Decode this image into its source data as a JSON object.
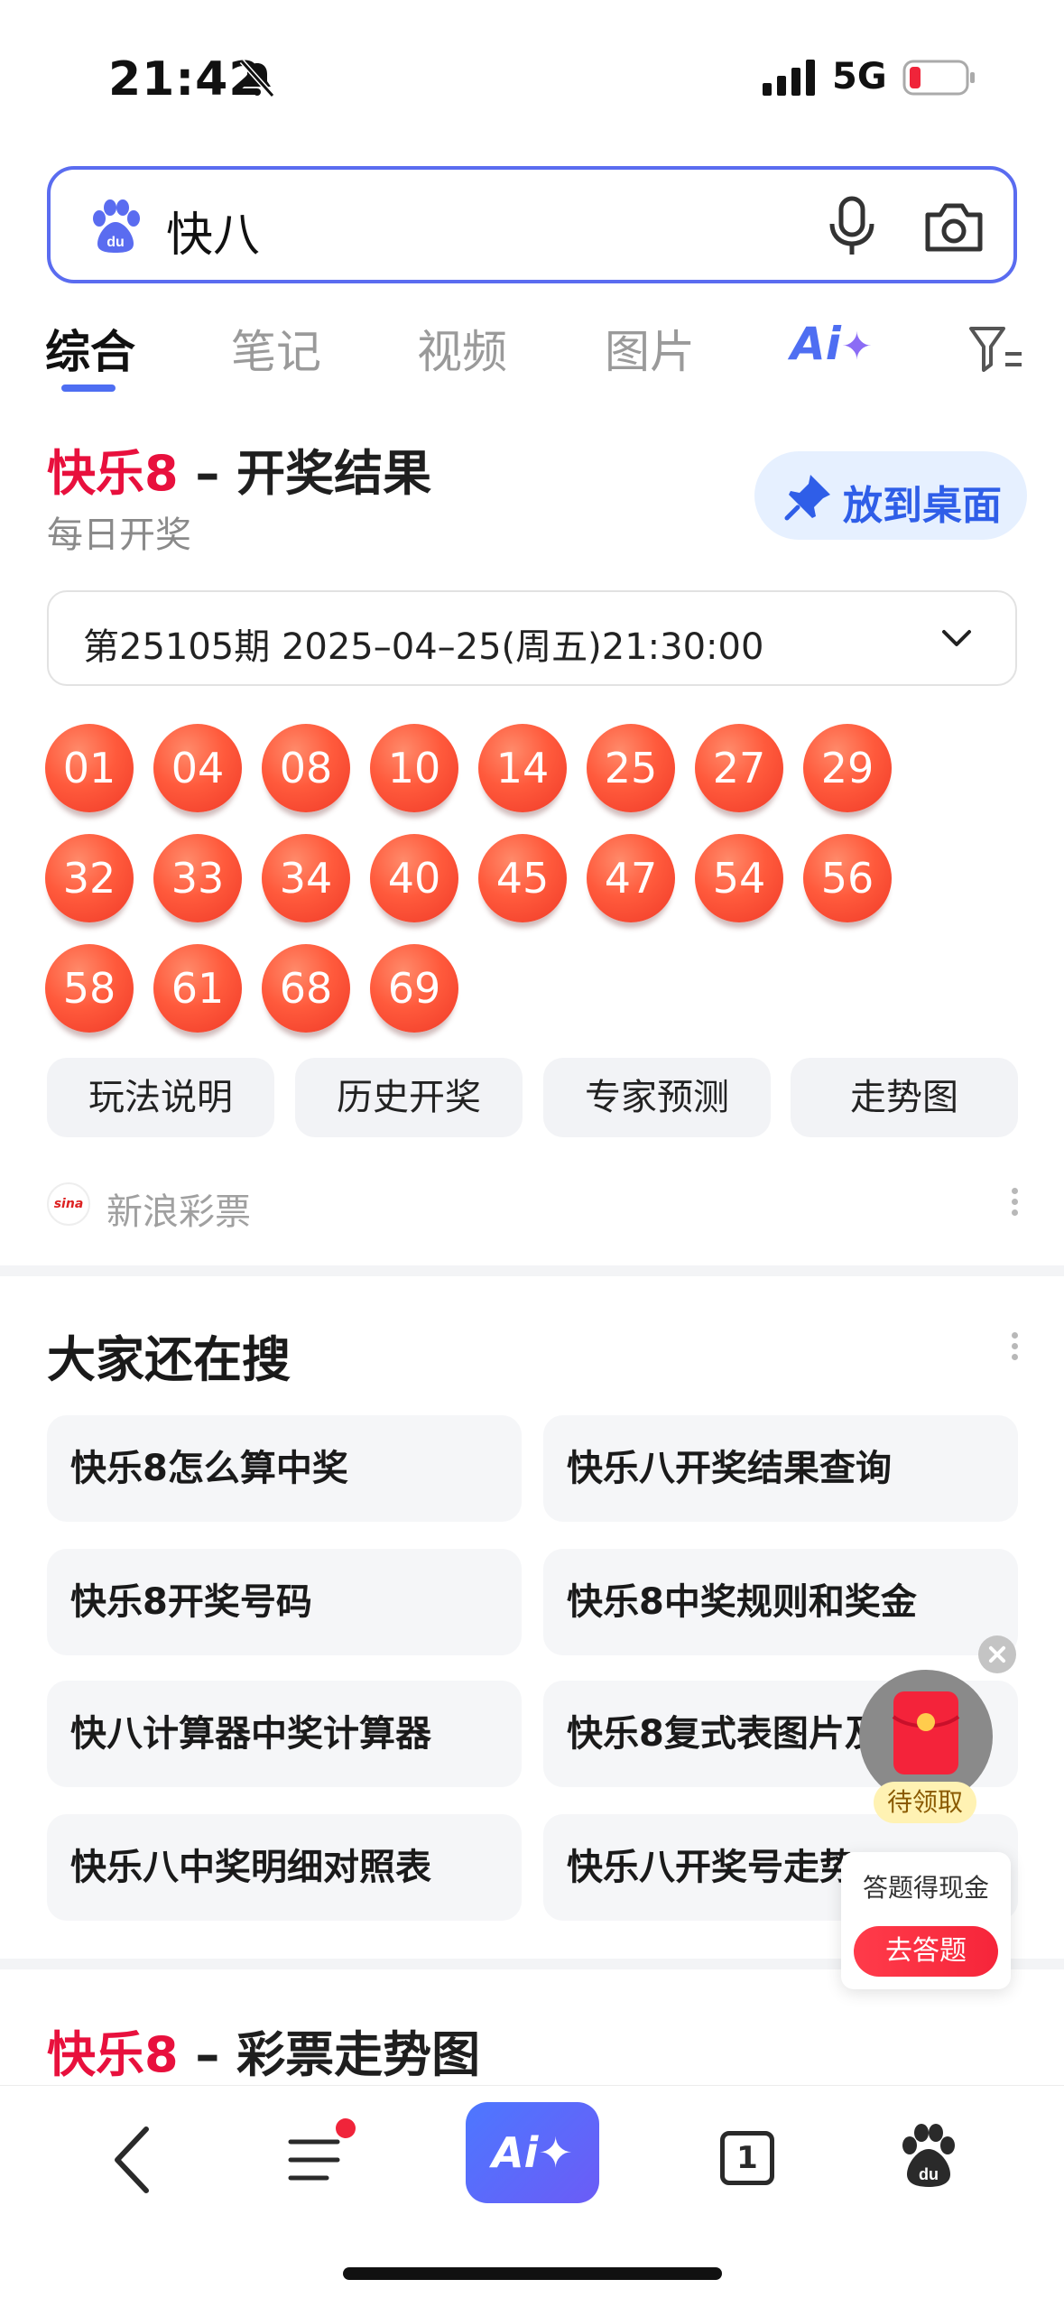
{
  "status_bar": {
    "time": "21:42",
    "network": "5G"
  },
  "search": {
    "query": "快八"
  },
  "tabs": [
    {
      "label": "综合",
      "active": true
    },
    {
      "label": "笔记",
      "active": false
    },
    {
      "label": "视频",
      "active": false
    },
    {
      "label": "图片",
      "active": false
    }
  ],
  "ai_tab": {
    "label": "Ai",
    "star": "✦"
  },
  "lottery": {
    "title_brand": "快乐8",
    "title_rest": " – 开奖结果",
    "subtitle": "每日开奖",
    "pin_label": "放到桌面",
    "period": "第25105期 2025–04–25(周五)21:30:00",
    "numbers": [
      "01",
      "04",
      "08",
      "10",
      "14",
      "25",
      "27",
      "29",
      "32",
      "33",
      "34",
      "40",
      "45",
      "47",
      "54",
      "56",
      "58",
      "61",
      "68",
      "69"
    ],
    "actions": [
      "玩法说明",
      "历史开奖",
      "专家预测",
      "走势图"
    ],
    "source": "新浪彩票",
    "source_logo": "sina"
  },
  "related": {
    "title": "大家还在搜",
    "items": [
      "快乐8怎么算中奖",
      "快乐八开奖结果查询",
      "快乐8开奖号码",
      "快乐8中奖规则和奖金",
      "快八计算器中奖计算器",
      "快乐8复式表图片及…",
      "快乐八中奖明细对照表",
      "快乐八开奖号走势…"
    ]
  },
  "float_widget": {
    "pending": "待领取",
    "quiz_text": "答题得现金",
    "quiz_button": "去答题"
  },
  "next_result": {
    "title_brand": "快乐8",
    "title_rest": " – 彩票走势图"
  },
  "bottom_bar": {
    "ai_label": "Ai✦",
    "tab_count": "1"
  },
  "colors": {
    "accent": "#4e6ef2",
    "brand_red": "#e8103d",
    "ball": "#ff5a3c"
  }
}
